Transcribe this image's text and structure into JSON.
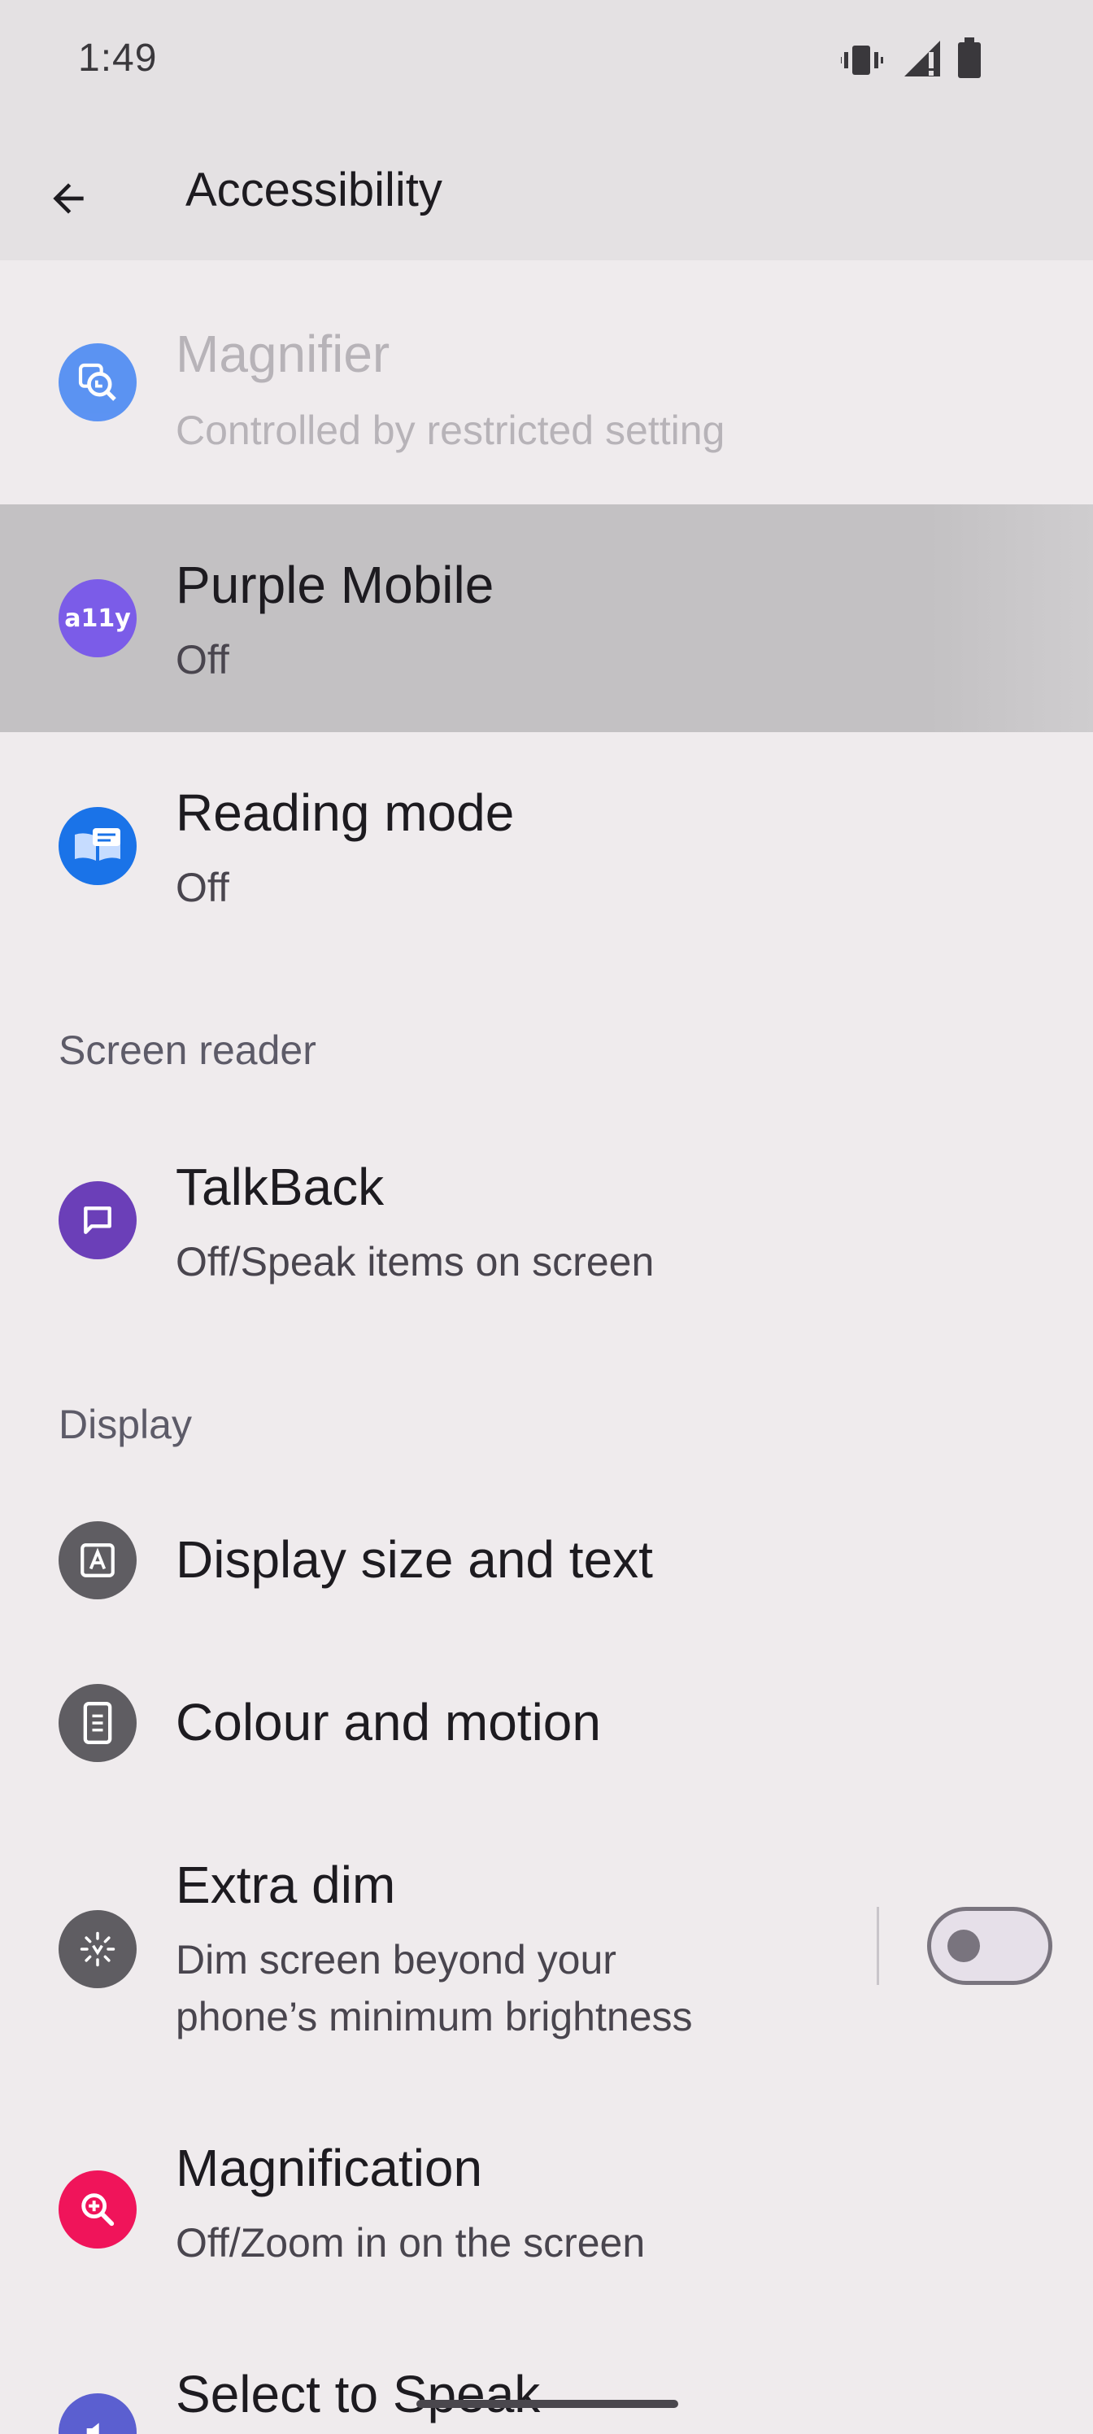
{
  "status_bar": {
    "time": "1:49",
    "icons": [
      "vibrate-icon",
      "signal-icon",
      "battery-icon"
    ]
  },
  "app_bar": {
    "title": "Accessibility",
    "back_icon": "arrow-back-icon"
  },
  "items": {
    "magnifier": {
      "title": "Magnifier",
      "subtitle": "Controlled by restricted setting",
      "icon_color": "#4b8af3",
      "disabled": true
    },
    "purple_mobile": {
      "title": "Purple Mobile",
      "subtitle": "Off",
      "icon_color": "#7b5ce8",
      "icon_text": "a11y"
    },
    "reading_mode": {
      "title": "Reading mode",
      "subtitle": "Off",
      "icon_color": "#1a73e8"
    },
    "talkback": {
      "title": "TalkBack",
      "subtitle": "Off/Speak items on screen",
      "icon_color": "#6b3fb8"
    },
    "display_size": {
      "title": "Display size and text",
      "icon_color": "#5f5d62"
    },
    "colour_motion": {
      "title": "Colour and motion",
      "icon_color": "#5f5d62"
    },
    "extra_dim": {
      "title": "Extra dim",
      "subtitle_line1": "Dim screen beyond your",
      "subtitle_line2": "phone’s minimum brightness",
      "icon_color": "#5f5d62",
      "toggle_on": false
    },
    "magnification": {
      "title": "Magnification",
      "subtitle": "Off/Zoom in on the screen",
      "icon_color": "#f0145a"
    },
    "select_to_speak": {
      "title": "Select to Speak",
      "icon_color": "#5b5fd0"
    }
  },
  "sections": {
    "screen_reader": "Screen reader",
    "display": "Display"
  }
}
